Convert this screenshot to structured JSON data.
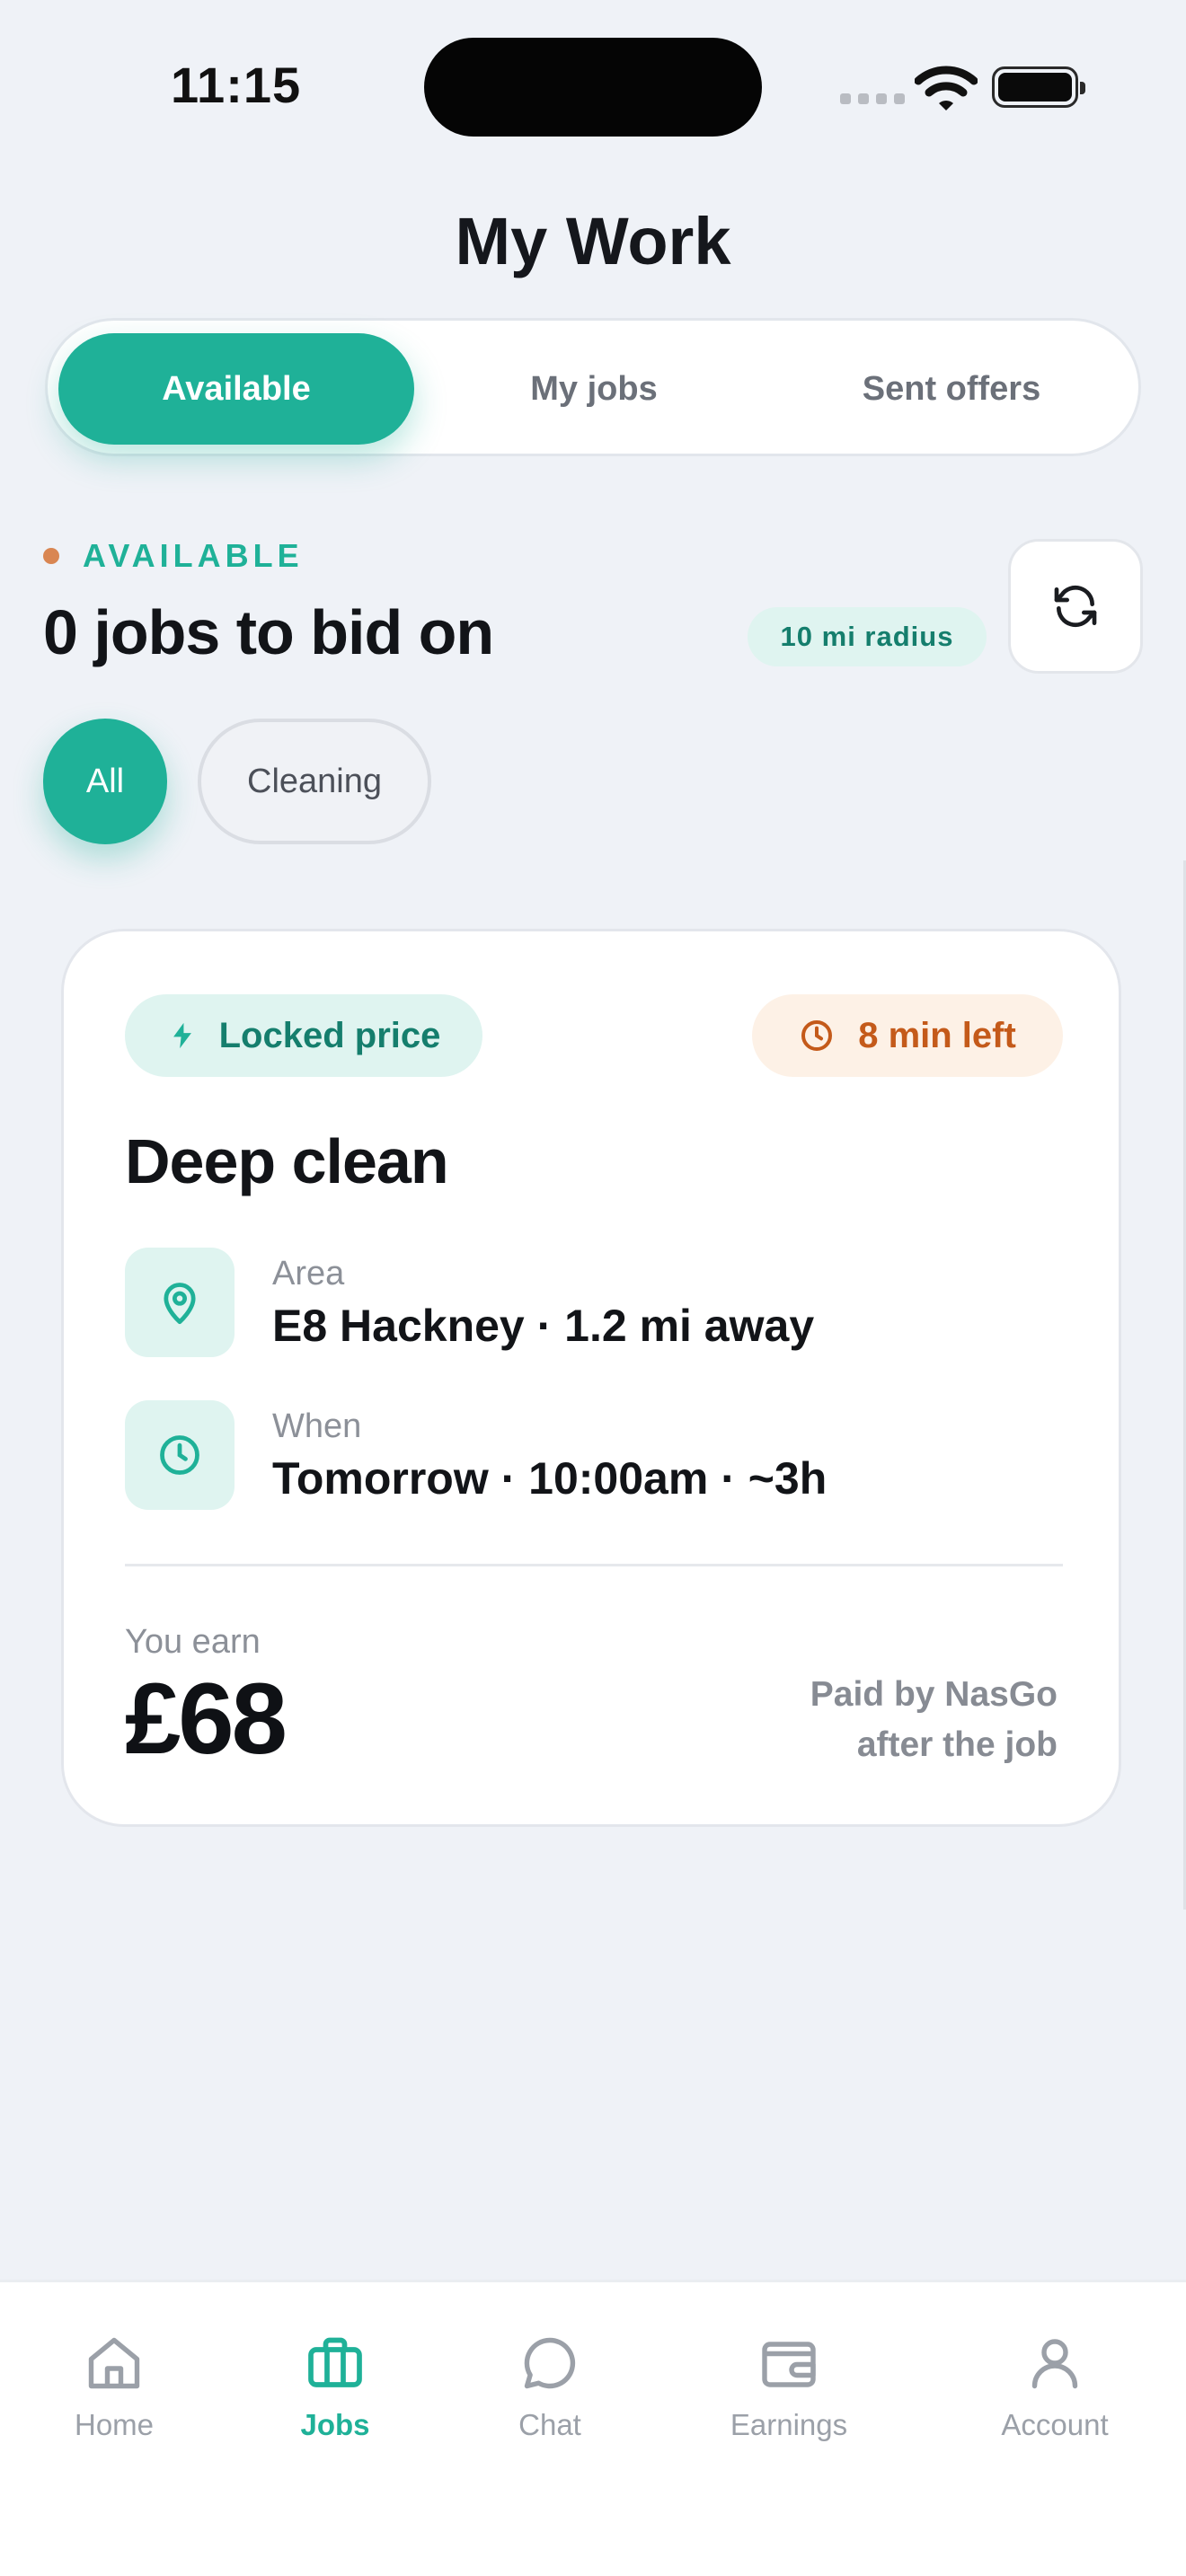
{
  "status_bar": {
    "time": "11:15"
  },
  "header": {
    "title": "My Work"
  },
  "tabs": [
    {
      "label": "Available",
      "active": true
    },
    {
      "label": "My jobs",
      "active": false
    },
    {
      "label": "Sent offers",
      "active": false
    }
  ],
  "section": {
    "label": "AVAILABLE",
    "title": "0 jobs to bid on",
    "radius_badge": "10 mi radius",
    "refresh_icon": "refresh-icon"
  },
  "filters": [
    {
      "label": "All",
      "active": true
    },
    {
      "label": "Cleaning",
      "active": false
    }
  ],
  "job_card": {
    "locked_badge": "Locked price",
    "timer_badge": "8 min left",
    "title": "Deep clean",
    "area": {
      "label": "Area",
      "value": "E8 Hackney · 1.2 mi away",
      "icon": "location-pin-icon"
    },
    "when": {
      "label": "When",
      "value": "Tomorrow · 10:00am · ~3h",
      "icon": "clock-icon"
    },
    "earn_label": "You earn",
    "earn_value": "£68",
    "paid_note_line1": "Paid by NasGo",
    "paid_note_line2": "after the job"
  },
  "bottom_nav": [
    {
      "label": "Home",
      "icon": "home-icon",
      "active": false
    },
    {
      "label": "Jobs",
      "icon": "briefcase-icon",
      "active": true
    },
    {
      "label": "Chat",
      "icon": "chat-bubble-icon",
      "active": false
    },
    {
      "label": "Earnings",
      "icon": "wallet-icon",
      "active": false
    },
    {
      "label": "Account",
      "icon": "user-icon",
      "active": false
    }
  ],
  "colors": {
    "accent": "#1fb198",
    "accent_soft": "#dff4f0",
    "warning": "#c45a1a",
    "warning_soft": "#fdf1e6",
    "background": "#eff2f7"
  }
}
